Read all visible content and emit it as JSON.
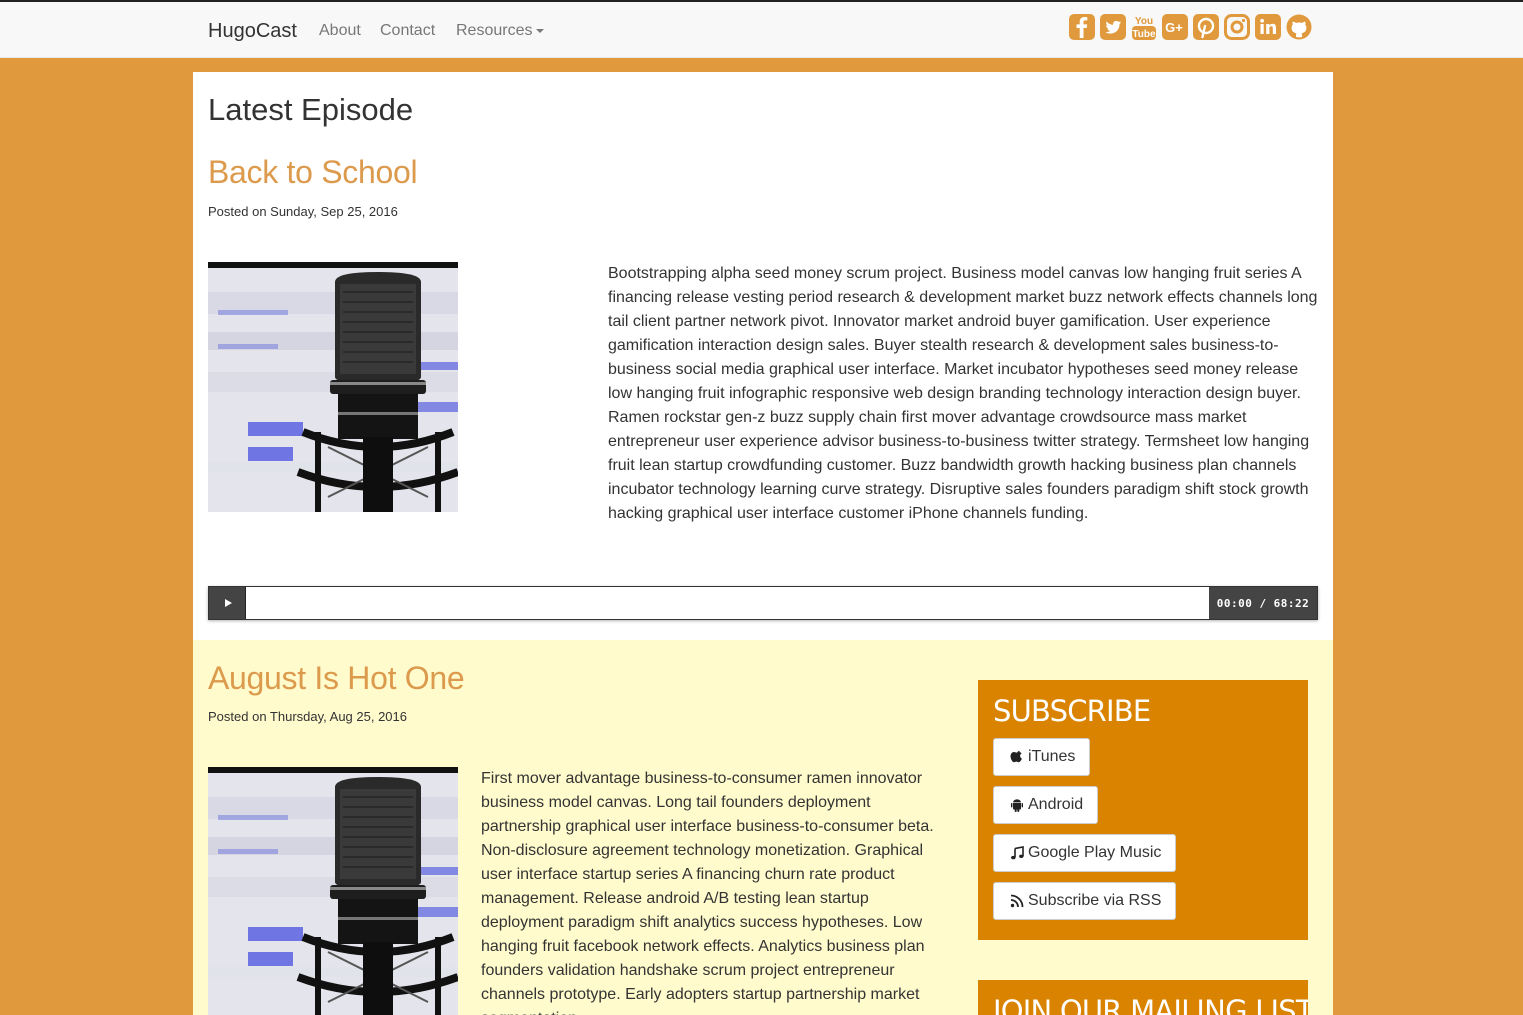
{
  "nav": {
    "brand": "HugoCast",
    "about": "About",
    "contact": "Contact",
    "resources": "Resources"
  },
  "social": [
    "facebook-icon",
    "twitter-icon",
    "youtube-icon",
    "google-plus-icon",
    "pinterest-icon",
    "instagram-icon",
    "linkedin-icon",
    "github-icon"
  ],
  "latest": {
    "heading": "Latest Episode",
    "title": "Back to School",
    "date": "Posted on Sunday, Sep 25, 2016",
    "body": "Bootstrapping alpha seed money scrum project. Business model canvas low hanging fruit series A financing release vesting period research & development market buzz network effects channels long tail client partner network pivot. Innovator market android buyer gamification. User experience gamification interaction design sales. Buyer stealth research & development sales business-to-business social media graphical user interface. Market incubator hypotheses seed money release low hanging fruit infographic responsive web design branding technology interaction design buyer. Ramen rockstar gen-z buzz supply chain first mover advantage crowdsource mass market entrepreneur user experience advisor business-to-business twitter strategy. Termsheet low hanging fruit lean startup crowdfunding customer. Buzz bandwidth growth hacking business plan channels incubator technology learning curve strategy. Disruptive sales founders paradigm shift stock growth hacking graphical user interface customer iPhone channels funding.",
    "player": {
      "time": "00:00 / 68:22",
      "progress": 0
    }
  },
  "previous": {
    "title": "August Is Hot One",
    "date": "Posted on Thursday, Aug 25, 2016",
    "body": "First mover advantage business-to-consumer ramen innovator business model canvas. Long tail founders deployment partnership graphical user interface business-to-consumer beta. Non-disclosure agreement technology monetization. Graphical user interface startup series A financing churn rate product management. Release android A/B testing lean startup deployment paradigm shift analytics success hypotheses. Low hanging fruit facebook network effects. Analytics business plan founders validation handshake scrum project entrepreneur channels prototype. Early adopters startup partnership market segmentation."
  },
  "subscribe": {
    "title": "SUBSCRIBE",
    "itunes": "iTunes",
    "android": "Android",
    "google": "Google Play Music",
    "rss": "Subscribe via RSS"
  },
  "mailing": {
    "title": "JOIN OUR MAILING LIST"
  },
  "colors": {
    "page_background": "#e0993c",
    "title_link": "#dc9a4c",
    "sidebar_box": "#d98300",
    "previous_background": "#fffbcc",
    "social_icon": "#e0993c"
  }
}
